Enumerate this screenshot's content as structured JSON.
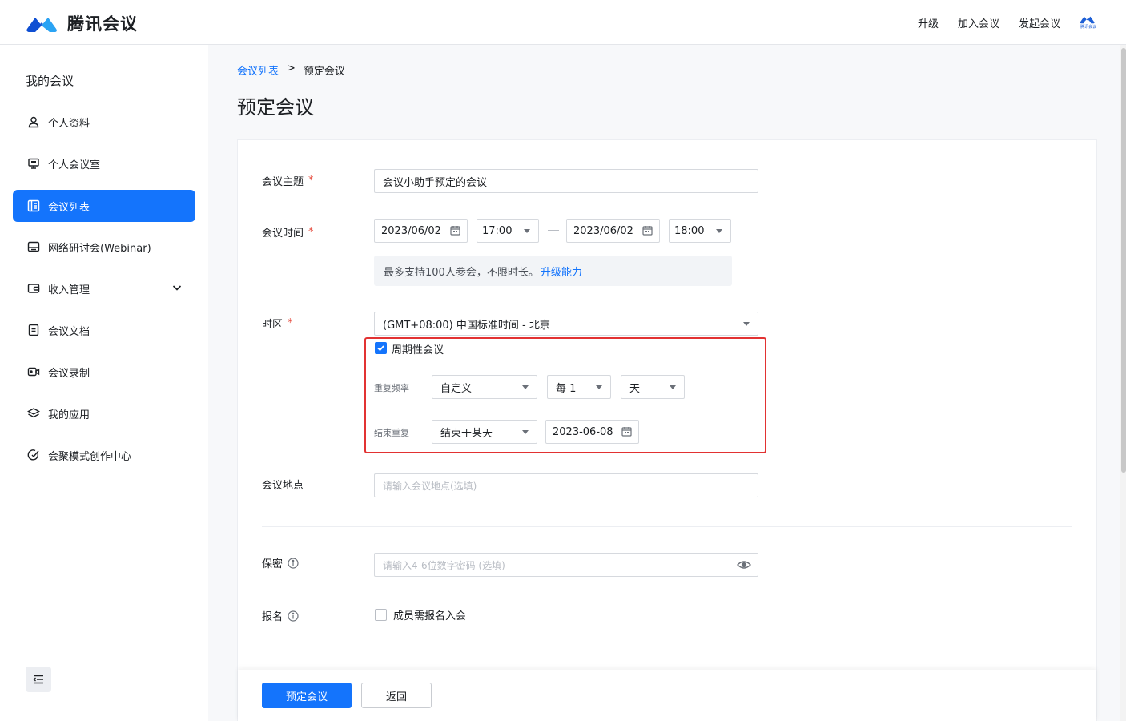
{
  "header": {
    "app_name": "腾讯会议",
    "nav": [
      "升级",
      "加入会议",
      "发起会议"
    ],
    "mini_logo_text": "腾讯会议"
  },
  "sidebar": {
    "title": "我的会议",
    "items": [
      {
        "label": "个人资料",
        "icon": "user-icon"
      },
      {
        "label": "个人会议室",
        "icon": "monitor-icon"
      },
      {
        "label": "会议列表",
        "icon": "list-icon",
        "active": true
      },
      {
        "label": "网络研讨会(Webinar)",
        "icon": "webinar-icon"
      },
      {
        "label": "收入管理",
        "icon": "wallet-icon",
        "expandable": true
      },
      {
        "label": "会议文档",
        "icon": "document-icon"
      },
      {
        "label": "会议录制",
        "icon": "video-icon"
      },
      {
        "label": "我的应用",
        "icon": "layers-icon"
      },
      {
        "label": "会聚模式创作中心",
        "icon": "creation-icon"
      }
    ]
  },
  "breadcrumb": {
    "parent": "会议列表",
    "separator": ">",
    "current": "预定会议"
  },
  "page_title": "预定会议",
  "form": {
    "subject": {
      "label": "会议主题",
      "value": "会议小助手预定的会议"
    },
    "time": {
      "label": "会议时间",
      "start_date": "2023/06/02",
      "start_time": "17:00",
      "end_date": "2023/06/02",
      "end_time": "18:00"
    },
    "notice": {
      "text": "最多支持100人参会，不限时长。",
      "link": "升级能力"
    },
    "timezone": {
      "label": "时区",
      "value": "(GMT+08:00) 中国标准时间 - 北京"
    },
    "recurring": {
      "checkbox_label": "周期性会议",
      "checked": true,
      "frequency_label": "重复频率",
      "frequency_value": "自定义",
      "interval_value": "每 1",
      "unit_value": "天",
      "end_label": "结束重复",
      "end_mode": "结束于某天",
      "end_date": "2023-06-08"
    },
    "location": {
      "label": "会议地点",
      "placeholder": "请输入会议地点(选填)"
    },
    "password": {
      "label": "保密",
      "placeholder": "请输入4-6位数字密码 (选填)"
    },
    "registration": {
      "label": "报名",
      "checkbox_label": "成员需报名入会",
      "checked": false
    }
  },
  "buttons": {
    "submit": "预定会议",
    "back": "返回"
  },
  "colors": {
    "primary": "#1474fc",
    "highlight_border": "#e23232",
    "required": "#e5483a"
  }
}
